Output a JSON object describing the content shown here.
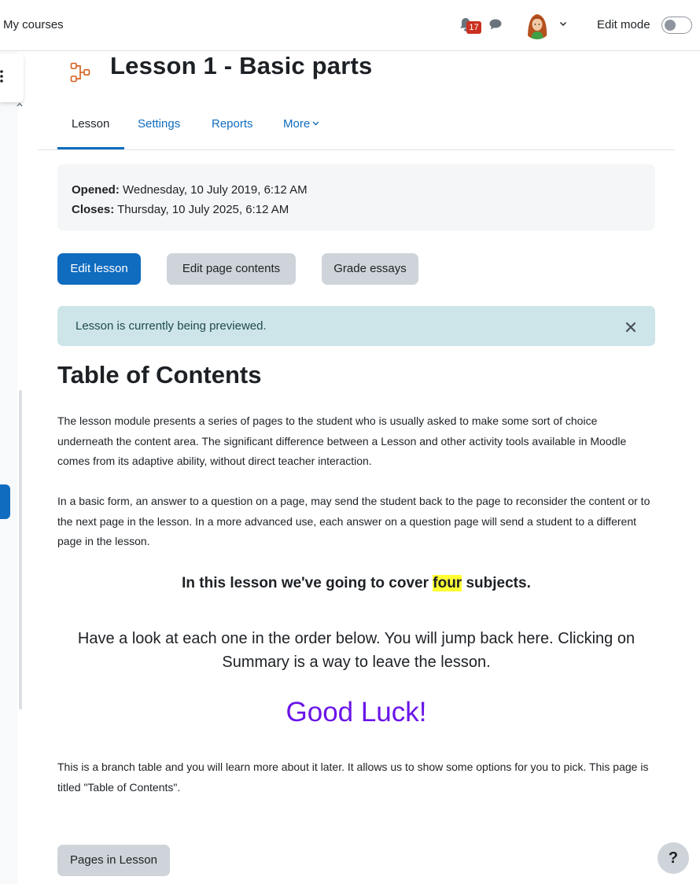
{
  "navbar": {
    "my_courses": "My courses",
    "notification_count": "17",
    "edit_mode_label": "Edit mode"
  },
  "header": {
    "title": "Lesson 1 - Basic parts"
  },
  "tabs": [
    {
      "label": "Lesson"
    },
    {
      "label": "Settings"
    },
    {
      "label": "Reports"
    },
    {
      "label": "More"
    }
  ],
  "dates": {
    "opened_label": "Opened:",
    "opened_value": " Wednesday, 10 July 2019, 6:12 AM",
    "closes_label": "Closes:",
    "closes_value": " Thursday, 10 July 2025, 6:12 AM"
  },
  "actions": {
    "edit_lesson": "Edit lesson",
    "edit_page_contents": "Edit page contents",
    "grade_essays": "Grade essays"
  },
  "alert": {
    "text": "Lesson is currently being previewed."
  },
  "content": {
    "title": "Table of Contents",
    "para1": "The lesson module presents a series of pages to the student who is usually asked to make some sort of choice underneath the content area. The significant difference between a Lesson and other activity tools available in Moodle comes from its adaptive ability, without direct teacher interaction.",
    "para2": "In a basic form, an answer to a question on a page, may send the student back to the page to reconsider the content or to the next page in the lesson. In a more advanced use, each answer on a question page will send a student to a different page in the lesson.",
    "subjects_before": "In this lesson we've going to cover ",
    "subjects_highlight": "four",
    "subjects_after": " subjects.",
    "look_text": "Have a look at each one in the order below. You will jump back here. Clicking on Summary is a way to leave the lesson.",
    "good_luck": "Good Luck!",
    "para3": "This is a branch table and you will learn more about it later. It allows us to show some options for you to pick. This page is titled \"Table of Contents\"."
  },
  "footer": {
    "pages_in_lesson": "Pages in Lesson",
    "help": "?"
  },
  "colors": {
    "primary": "#0f6cbf",
    "good_luck": "#6a14e8",
    "highlight": "#ffff33",
    "alert_bg": "#cde5e8",
    "badge": "#ca3120"
  }
}
